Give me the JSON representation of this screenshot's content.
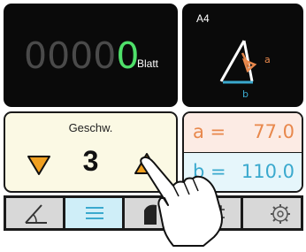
{
  "counter": {
    "zeros": "0000",
    "active_digit": "0",
    "unit": "Blatt"
  },
  "format": {
    "paper": "A4",
    "side_a_label": "a",
    "side_b_label": "b"
  },
  "speed": {
    "label": "Geschw.",
    "value": "3"
  },
  "dimensions": {
    "a": {
      "label": "a =",
      "value": "77.0"
    },
    "b": {
      "label": "b =",
      "value": "110.0"
    }
  },
  "toolbar": {
    "tabs": [
      {
        "icon": "angle-icon"
      },
      {
        "icon": "menu-icon",
        "selected": true
      },
      {
        "icon": "cut-icon"
      },
      {
        "icon": "crop-icon"
      },
      {
        "icon": "gear-icon"
      }
    ]
  },
  "colors": {
    "counter_active": "#4fe06a",
    "accent_orange": "#f0a020",
    "dim_a": "#e8884c",
    "dim_b": "#3aa9ce",
    "speed_bg": "#fbf9e4"
  }
}
